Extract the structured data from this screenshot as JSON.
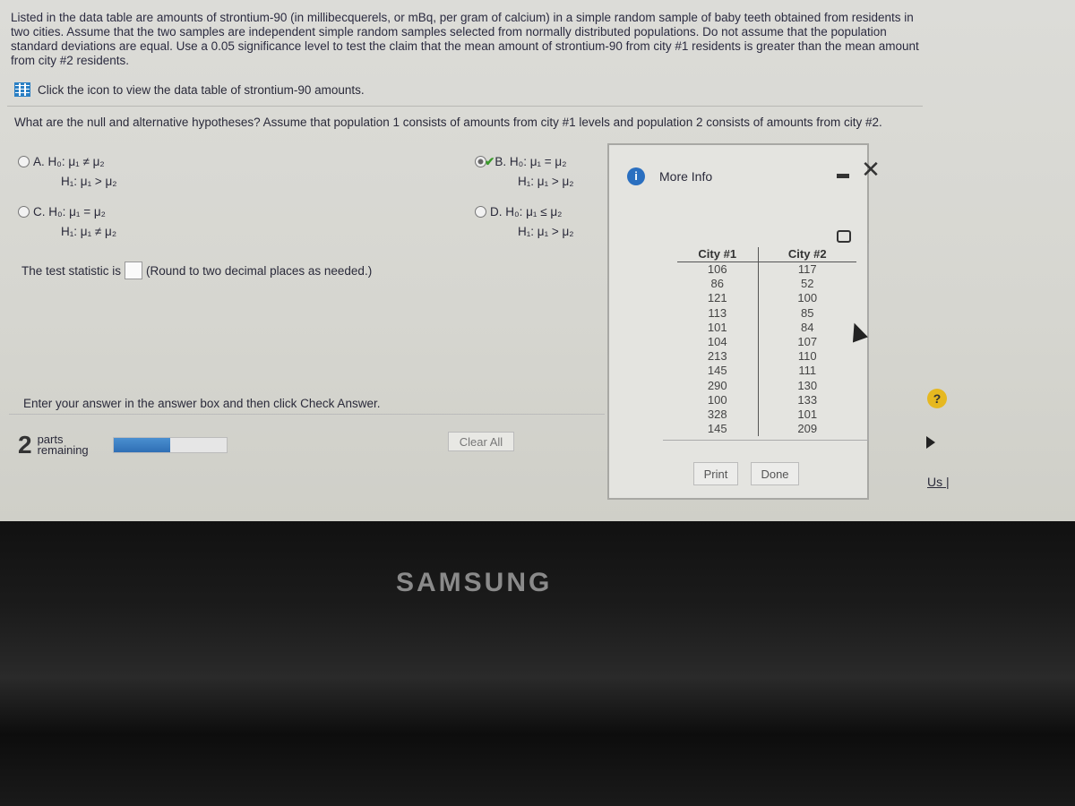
{
  "intro_text": "Listed in the data table are amounts of strontium-90 (in millibecquerels, or mBq, per gram of calcium) in a simple random sample of baby teeth obtained from residents in two cities. Assume that the two samples are independent simple random samples selected from normally distributed populations. Do not assume that the population standard deviations are equal. Use a 0.05 significance level to test the claim that the mean amount of strontium-90 from city #1 residents is greater than the mean amount from city #2 residents.",
  "data_table_link": "Click the icon to view the data table of strontium-90 amounts.",
  "question": "What are the null and alternative hypotheses? Assume that population 1 consists of amounts from city #1 levels and population 2 consists of amounts from city #2.",
  "options": [
    {
      "letter": "A.",
      "h0": "H₀: μ₁ ≠ μ₂",
      "h1": "H₁: μ₁ > μ₂",
      "selected": false
    },
    {
      "letter": "B.",
      "h0": "H₀: μ₁ = μ₂",
      "h1": "H₁: μ₁ > μ₂",
      "selected": true
    },
    {
      "letter": "C.",
      "h0": "H₀: μ₁ = μ₂",
      "h1": "H₁: μ₁ ≠ μ₂",
      "selected": false
    },
    {
      "letter": "D.",
      "h0": "H₀: μ₁ ≤ μ₂",
      "h1": "H₁: μ₁ > μ₂",
      "selected": false
    }
  ],
  "test_statistic": {
    "label": "The test statistic is",
    "value": "",
    "hint": "(Round to two decimal places as needed.)"
  },
  "enter_answer": "Enter your answer in the answer box and then click Check Answer.",
  "parts": {
    "count": "2",
    "label1": "parts",
    "label2": "remaining",
    "progress_percent": 50
  },
  "clear_all": "Clear All",
  "popup": {
    "title": "More Info",
    "close": "✕",
    "columns": [
      "City #1",
      "City #2"
    ],
    "rows": [
      [
        106,
        117
      ],
      [
        86,
        52
      ],
      [
        121,
        100
      ],
      [
        113,
        85
      ],
      [
        101,
        84
      ],
      [
        104,
        107
      ],
      [
        213,
        110
      ],
      [
        145,
        111
      ],
      [
        290,
        130
      ],
      [
        100,
        133
      ],
      [
        328,
        101
      ],
      [
        145,
        209
      ]
    ],
    "print": "Print",
    "done": "Done"
  },
  "help": "?",
  "footer_link": "Us |",
  "brand": "SAMSUNG",
  "colors": {
    "accent": "#2a6fc0",
    "check": "#3a9a2a",
    "help": "#e6b820"
  }
}
